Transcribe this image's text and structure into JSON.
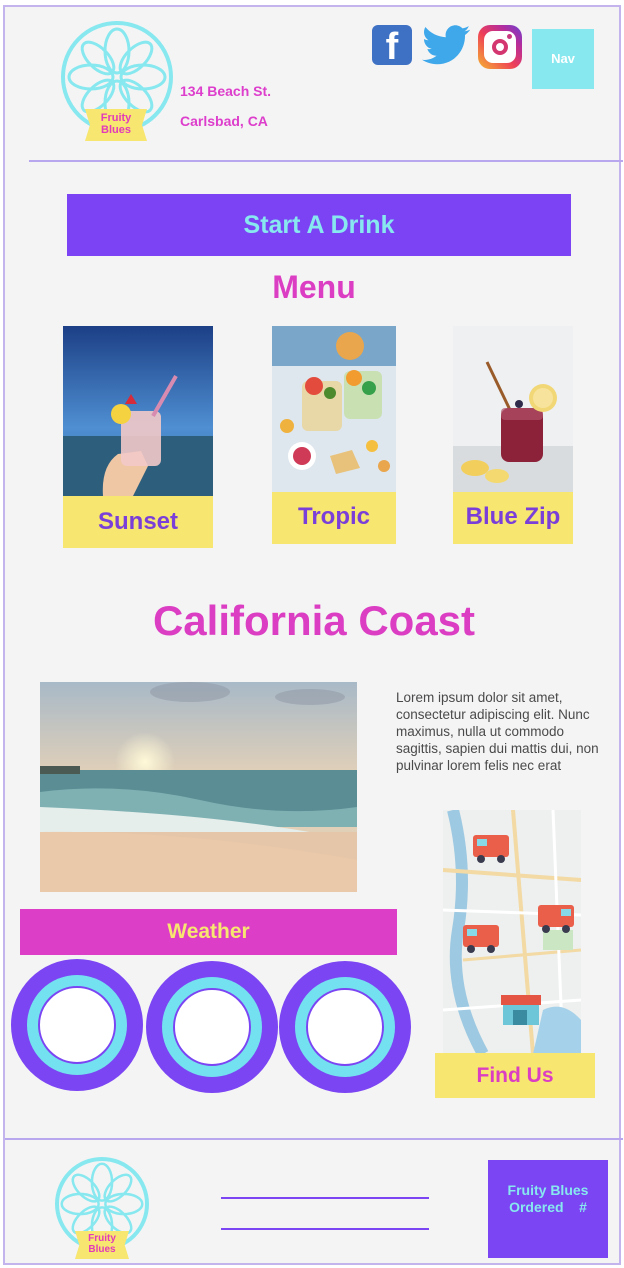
{
  "header": {
    "logo_text": "Fruity\nBlues",
    "address_line1": "134 Beach St.",
    "address_line2": "Carlsbad, CA",
    "nav_label": "Nav",
    "icons": [
      "facebook-icon",
      "twitter-icon",
      "instagram-icon"
    ]
  },
  "cta": {
    "start_label": "Start A Drink"
  },
  "menu": {
    "title": "Menu",
    "items": [
      {
        "label": "Sunset"
      },
      {
        "label": "Tropic"
      },
      {
        "label": "Blue Zip"
      }
    ]
  },
  "coast": {
    "title": "California Coast",
    "body": "Lorem ipsum dolor sit amet, consectetur adipiscing elit. Nunc maximus, nulla ut commodo sagittis, sapien dui mattis dui, non pulvinar lorem felis nec erat"
  },
  "weather": {
    "label": "Weather"
  },
  "find": {
    "label": "Find Us"
  },
  "footer": {
    "box_line1": "Fruity Blues",
    "box_line2": "Ordered    #"
  },
  "colors": {
    "purple": "#7b45f3",
    "magenta": "#db3ec2",
    "cyan": "#87e8ef",
    "yellow": "#f7e66f"
  }
}
